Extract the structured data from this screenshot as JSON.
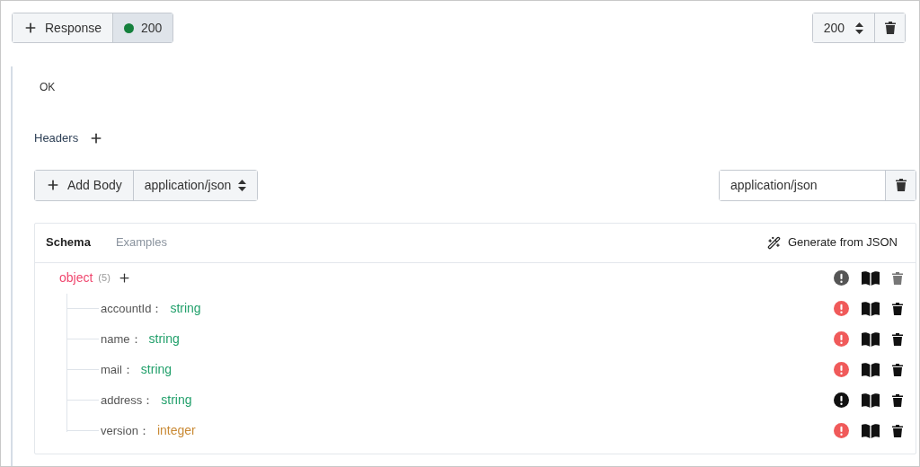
{
  "response_bar": {
    "add_label": "Response",
    "status": {
      "code": "200",
      "color": "#15803d",
      "selected": true
    },
    "code_select": "200"
  },
  "description": "OK",
  "headers": {
    "label": "Headers"
  },
  "body": {
    "add_label": "Add Body",
    "media_select": "application/json",
    "media_field": "application/json"
  },
  "schema": {
    "tabs": [
      {
        "label": "Schema",
        "selected": true
      },
      {
        "label": "Examples",
        "selected": false
      }
    ],
    "generate_label": "Generate from JSON",
    "root": {
      "type": "object",
      "count": "(5)",
      "disabled": true
    },
    "fields": [
      {
        "name": "accountId：",
        "type": "string",
        "color": "#22a06b",
        "required": true
      },
      {
        "name": "name：",
        "type": "string",
        "color": "#22a06b",
        "required": true
      },
      {
        "name": "mail：",
        "type": "string",
        "color": "#22a06b",
        "required": true
      },
      {
        "name": "address：",
        "type": "string",
        "color": "#22a06b",
        "required": false
      },
      {
        "name": "version：",
        "type": "integer",
        "color": "#c98a35",
        "required": true
      }
    ]
  }
}
